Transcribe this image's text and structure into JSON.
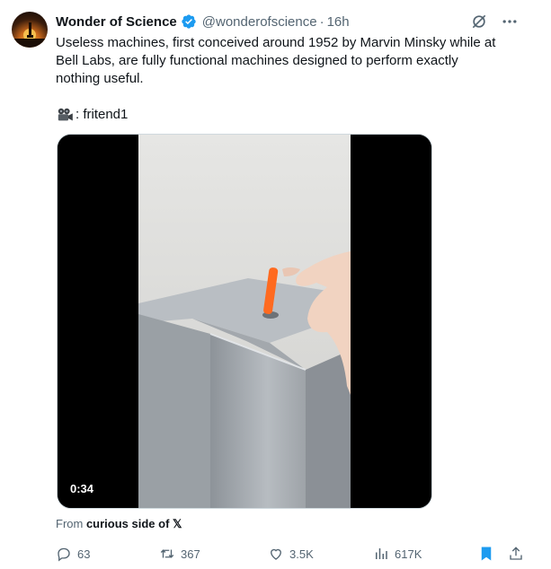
{
  "author": {
    "name": "Wonder of Science",
    "handle": "@wonderofscience",
    "separator": "·",
    "time": "16h",
    "verified": true,
    "verified_color": "#1d9bf0"
  },
  "top_actions": {
    "grok_icon": "grok-icon",
    "more_icon": "more-dots-icon"
  },
  "tweet": {
    "text": "Useless machines, first conceived around 1952 by Marvin Minsky while at Bell Labs, are fully functional machines designed to perform exactly nothing useful.",
    "credit": ": fritend1",
    "credit_icon": "movie-camera-icon"
  },
  "media": {
    "type": "video",
    "duration": "0:34"
  },
  "source": {
    "prefix": "From ",
    "name": "curious side of 𝕏"
  },
  "actions": {
    "replies": "63",
    "reposts": "367",
    "likes": "3.5K",
    "views": "617K",
    "bookmark_color": "#1d9bf0"
  },
  "colors": {
    "text": "#0f1419",
    "secondary": "#536471",
    "accent": "#1d9bf0"
  }
}
